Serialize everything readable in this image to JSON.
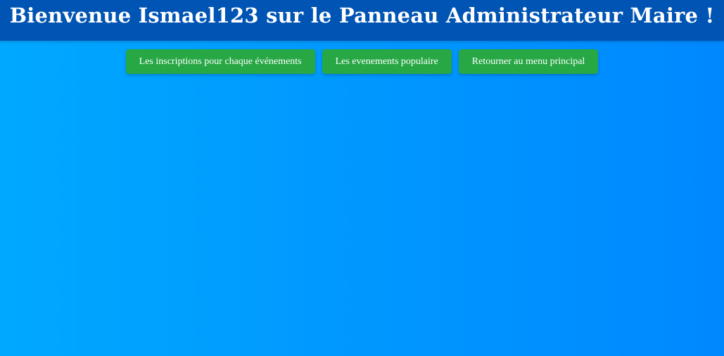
{
  "header": {
    "title": "Bienvenue Ismael123 sur le Panneau Administrateur Maire !"
  },
  "nav": {
    "buttons": [
      {
        "label": "Les inscriptions pour chaque événements"
      },
      {
        "label": "Les evenements populaire"
      },
      {
        "label": "Retourner au menu principal"
      }
    ]
  },
  "colors": {
    "header_bg": "#0054b4",
    "page_gradient_start": "#00a8ff",
    "page_gradient_end": "#0088ff",
    "button_bg": "#28a745",
    "text": "#ffffff"
  }
}
